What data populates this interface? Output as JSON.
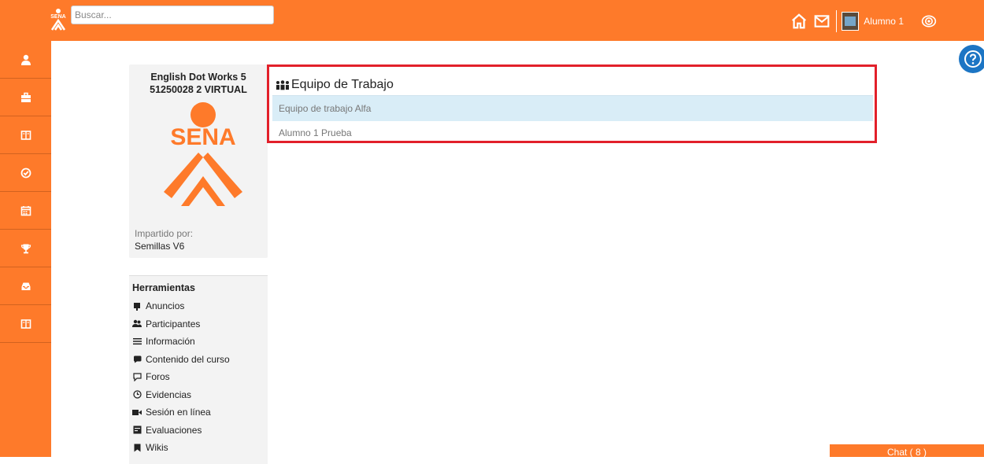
{
  "header": {
    "search_placeholder": "Buscar...",
    "user_name": "Alumno 1",
    "logo_text": "SENA"
  },
  "sidebar": {
    "items": [
      {
        "icon": "user-icon"
      },
      {
        "icon": "briefcase-icon"
      },
      {
        "icon": "book-icon"
      },
      {
        "icon": "check-circle-icon"
      },
      {
        "icon": "calendar-icon"
      },
      {
        "icon": "trophy-icon"
      },
      {
        "icon": "inbox-icon"
      },
      {
        "icon": "book-icon"
      }
    ]
  },
  "course": {
    "title_line1": "English Dot Works 5",
    "title_line2": "51250028 2 VIRTUAL",
    "logo_text": "SENA",
    "taught_by_label": "Impartido por:",
    "taught_by_name": "Semillas V6"
  },
  "tools": {
    "title": "Herramientas",
    "items": [
      {
        "label": "Anuncios",
        "icon": "announcement-icon"
      },
      {
        "label": "Participantes",
        "icon": "users-icon"
      },
      {
        "label": "Información",
        "icon": "list-icon"
      },
      {
        "label": "Contenido del curso",
        "icon": "content-icon"
      },
      {
        "label": "Foros",
        "icon": "forum-icon"
      },
      {
        "label": "Evidencias",
        "icon": "clock-icon"
      },
      {
        "label": "Sesión en línea",
        "icon": "video-icon"
      },
      {
        "label": "Evaluaciones",
        "icon": "evaluation-icon"
      },
      {
        "label": "Wikis",
        "icon": "bookmark-icon"
      }
    ]
  },
  "team": {
    "heading": "Equipo de Trabajo",
    "team_name": "Equipo de trabajo Alfa",
    "member": "Alumno 1 Prueba"
  },
  "chat": {
    "label": "Chat ( 8 )"
  },
  "colors": {
    "brand_orange": "#fe7a2a",
    "highlight_red": "#e2202a",
    "row_blue": "#d9edf7",
    "help_blue": "#1c75c4"
  }
}
